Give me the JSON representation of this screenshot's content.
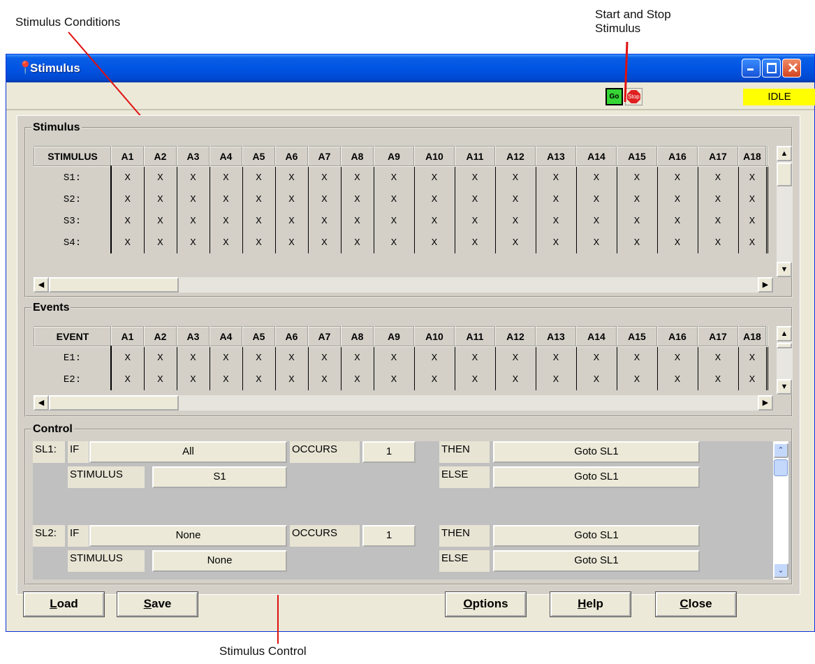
{
  "annotations": {
    "stimulus_conditions": "Stimulus Conditions",
    "start_stop_line1": "Start and Stop",
    "start_stop_line2": "Stimulus",
    "stimulus_control": "Stimulus Control"
  },
  "window": {
    "title": "Stimulus",
    "icon": "pin-icon"
  },
  "toolbar": {
    "go_label": "Go",
    "stop_label": "Stop",
    "status": "IDLE",
    "status_color": "#ffff00"
  },
  "stimulus": {
    "legend": "Stimulus",
    "header": "STIMULUS",
    "columns": [
      "A1",
      "A2",
      "A3",
      "A4",
      "A5",
      "A6",
      "A7",
      "A8",
      "A9",
      "A10",
      "A11",
      "A12",
      "A13",
      "A14",
      "A15",
      "A16",
      "A17",
      "A18"
    ],
    "rows": [
      {
        "label": "S1:",
        "cells": [
          "X",
          "X",
          "X",
          "X",
          "X",
          "X",
          "X",
          "X",
          "X",
          "X",
          "X",
          "X",
          "X",
          "X",
          "X",
          "X",
          "X",
          "X"
        ]
      },
      {
        "label": "S2:",
        "cells": [
          "X",
          "X",
          "X",
          "X",
          "X",
          "X",
          "X",
          "X",
          "X",
          "X",
          "X",
          "X",
          "X",
          "X",
          "X",
          "X",
          "X",
          "X"
        ]
      },
      {
        "label": "S3:",
        "cells": [
          "X",
          "X",
          "X",
          "X",
          "X",
          "X",
          "X",
          "X",
          "X",
          "X",
          "X",
          "X",
          "X",
          "X",
          "X",
          "X",
          "X",
          "X"
        ]
      },
      {
        "label": "S4:",
        "cells": [
          "X",
          "X",
          "X",
          "X",
          "X",
          "X",
          "X",
          "X",
          "X",
          "X",
          "X",
          "X",
          "X",
          "X",
          "X",
          "X",
          "X",
          "X"
        ]
      }
    ]
  },
  "events": {
    "legend": "Events",
    "header": "EVENT",
    "columns": [
      "A1",
      "A2",
      "A3",
      "A4",
      "A5",
      "A6",
      "A7",
      "A8",
      "A9",
      "A10",
      "A11",
      "A12",
      "A13",
      "A14",
      "A15",
      "A16",
      "A17",
      "A18"
    ],
    "rows": [
      {
        "label": "E1:",
        "cells": [
          "X",
          "X",
          "X",
          "X",
          "X",
          "X",
          "X",
          "X",
          "X",
          "X",
          "X",
          "X",
          "X",
          "X",
          "X",
          "X",
          "X",
          "X"
        ]
      },
      {
        "label": "E2:",
        "cells": [
          "X",
          "X",
          "X",
          "X",
          "X",
          "X",
          "X",
          "X",
          "X",
          "X",
          "X",
          "X",
          "X",
          "X",
          "X",
          "X",
          "X",
          "X"
        ]
      }
    ]
  },
  "control": {
    "legend": "Control",
    "labels": {
      "if": "IF",
      "occurs": "OCCURS",
      "then": "THEN",
      "stimulus": "STIMULUS",
      "else": "ELSE"
    },
    "rows": [
      {
        "id": "SL1:",
        "if_value": "All",
        "occurs_value": "1",
        "then_value": "Goto SL1",
        "stimulus_value": "S1",
        "else_value": "Goto SL1"
      },
      {
        "id": "SL2:",
        "if_value": "None",
        "occurs_value": "1",
        "then_value": "Goto SL1",
        "stimulus_value": "None",
        "else_value": "Goto SL1"
      }
    ]
  },
  "buttons": {
    "load": {
      "key": "L",
      "rest": "oad"
    },
    "save": {
      "key": "S",
      "rest": "ave"
    },
    "options": {
      "key": "O",
      "rest": "ptions"
    },
    "help": {
      "key": "H",
      "rest": "elp"
    },
    "close": {
      "key": "C",
      "rest": "lose"
    }
  }
}
